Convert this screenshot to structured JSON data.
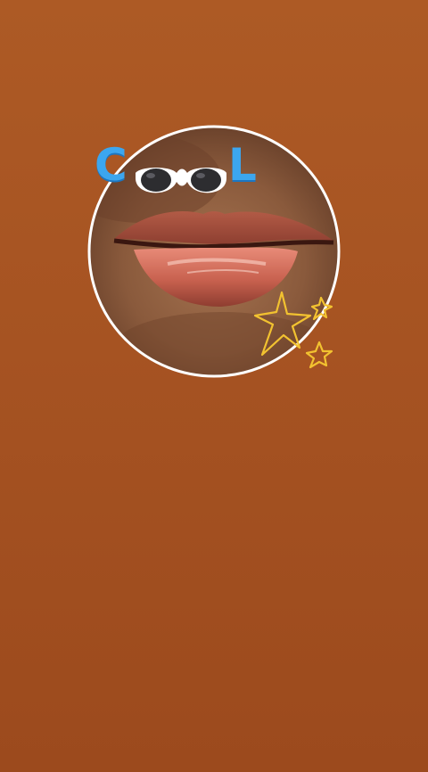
{
  "sticker": {
    "text_letters": [
      "C",
      "L"
    ],
    "accent_color": "#3ca6ef",
    "ring_color": "#ffffff",
    "star_color": "#f2c230",
    "background_color": "#a65322",
    "icons": [
      "sunglasses-icon",
      "star-icon"
    ]
  }
}
